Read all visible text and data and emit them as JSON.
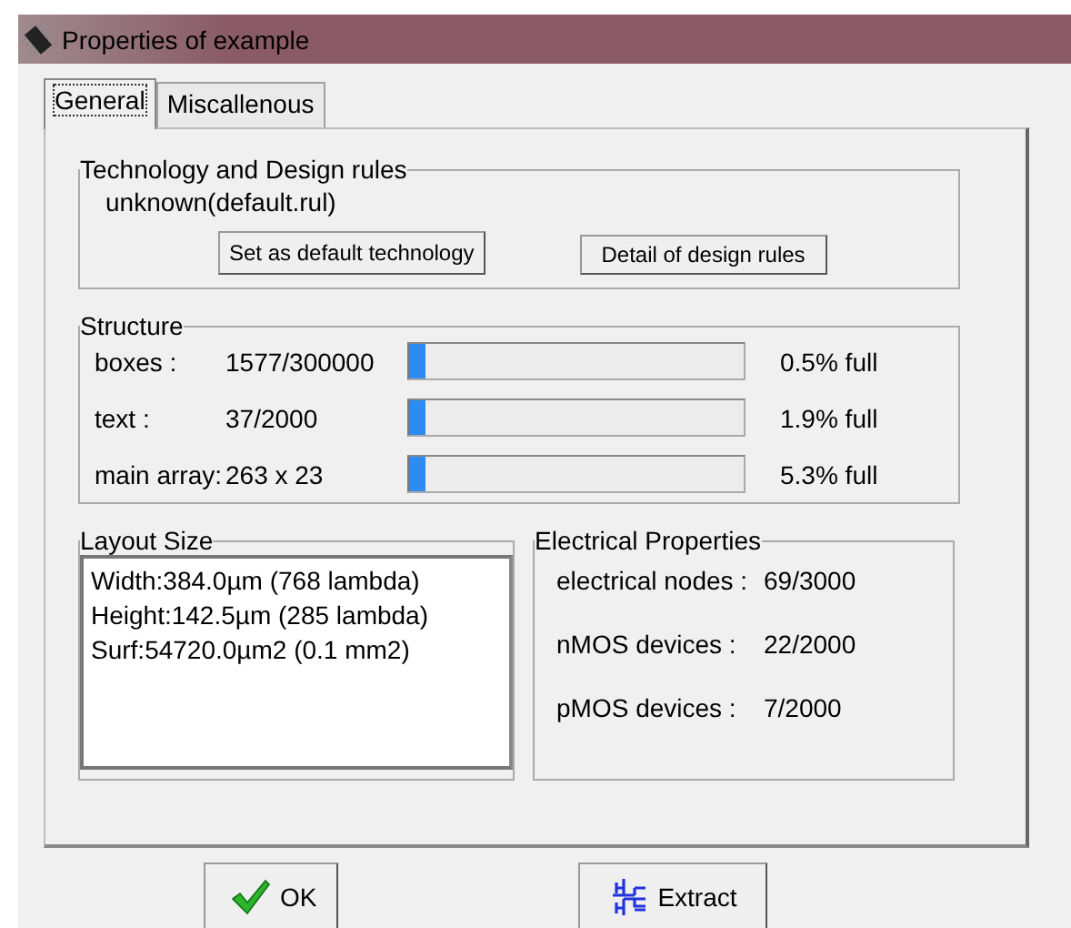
{
  "window": {
    "title": "Properties of example"
  },
  "tabs": [
    {
      "label": "General",
      "selected": true
    },
    {
      "label": "Miscallenous",
      "selected": false
    }
  ],
  "technology": {
    "title": "Technology and Design rules",
    "value": "unknown(default.rul)",
    "buttons": [
      "Set as default technology",
      "Detail of design rules"
    ]
  },
  "structure": {
    "title": "Structure",
    "rows": [
      {
        "label": "boxes :",
        "count": "1577/300000",
        "level": 0.05,
        "reading": "0.5% full"
      },
      {
        "label": "text  :",
        "count": "37/2000",
        "level": 0.05,
        "reading": "1.9% full"
      },
      {
        "label": "main array:",
        "count": "263 x 23",
        "level": 0.05,
        "reading": "5.3% full"
      }
    ]
  },
  "layout_size": {
    "title": "Layout Size",
    "lines": [
      "Width:384.0µm (768 lambda)",
      "Height:142.5µm (285 lambda)",
      "Surf:54720.0µm2 (0.1 mm2)"
    ]
  },
  "electrical": {
    "title": "Electrical Properties",
    "rows": [
      {
        "label": "electrical nodes :",
        "value": "69/3000"
      },
      {
        "label": "nMOS devices :",
        "value": "22/2000"
      },
      {
        "label": "pMOS devices :",
        "value": "7/2000"
      }
    ]
  },
  "buttons": [
    {
      "label": "OK",
      "kind": "ok"
    },
    {
      "label": "Extract",
      "kind": "extract"
    }
  ]
}
